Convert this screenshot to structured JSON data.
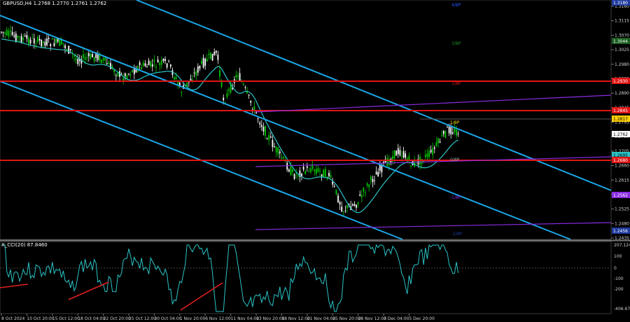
{
  "window": {
    "title": "GBPUSD,H4  1.2768 1.2770 1.2761 1.2762"
  },
  "colors": {
    "background": "#000000",
    "bull_candle": "#00c800",
    "bear_candle": "#ffffff",
    "channel": "#1aa7e6",
    "ma": "#2bc4c7",
    "resistance_red": "#e01414",
    "murrey_purple": "#8a2be2",
    "cci_line": "#2bc4c7",
    "divergence": "#e02020"
  },
  "price_axis": {
    "labels": [
      "1.3160",
      "1.3115",
      "1.3070",
      "1.3025",
      "1.2980",
      "1.2935",
      "1.2890",
      "1.2845",
      "1.2795",
      "1.2750",
      "1.2705",
      "1.2660",
      "1.2615",
      "1.2570",
      "1.2525",
      "1.2480",
      "1.2435"
    ]
  },
  "price_tags": [
    {
      "id": "tag-1",
      "text": "1.2817",
      "color": "#ffd000",
      "textColor": "#000"
    },
    {
      "id": "tag-2",
      "text": "1.2762",
      "color": "#ffffff",
      "textColor": "#000"
    },
    {
      "id": "tag-3",
      "text": "1.2695",
      "color": "#2bc4c7",
      "textColor": "#000"
    },
    {
      "id": "tag-4",
      "text": "1.2680",
      "color": "#e01414",
      "textColor": "#fff"
    },
    {
      "id": "tag-5",
      "text": "1.2930",
      "color": "#e01414",
      "textColor": "#fff"
    },
    {
      "id": "tag-6",
      "text": "1.2845",
      "color": "#e01414",
      "textColor": "#fff"
    },
    {
      "id": "tag-7",
      "text": "1.2562",
      "color": "#8a2be2",
      "textColor": "#fff"
    },
    {
      "id": "tag-8",
      "text": "1.3180",
      "color": "#1e3aa0",
      "textColor": "#fff"
    },
    {
      "id": "tag-9",
      "text": "1.3044",
      "color": "#1b5e20",
      "textColor": "#fff"
    },
    {
      "id": "tag-10",
      "text": "1.2456",
      "color": "#1e3aa0",
      "textColor": "#fff"
    }
  ],
  "level_labels": [
    {
      "id": "lvl-red-1",
      "text": "1/8P",
      "color": "#e01414"
    },
    {
      "id": "lvl-yellow",
      "text": "1/8P",
      "color": "#ffd000"
    },
    {
      "id": "lvl-pivot",
      "text": "0/8P",
      "color": "#9aa0a6"
    },
    {
      "id": "lvl-blue",
      "text": "4/8P",
      "color": "#2255ff"
    },
    {
      "id": "lvl-green",
      "text": "3/8P",
      "color": "#1b8f2a"
    },
    {
      "id": "lvl-purple",
      "text": "-1/8P",
      "color": "#8a2be2"
    },
    {
      "id": "lvl-blue-low",
      "text": "-2/8P",
      "color": "#1e3aa0"
    }
  ],
  "cci": {
    "title": "X_CCI(20) 87.8460",
    "axis_labels": [
      "207.1248",
      "100",
      "0",
      "-100",
      "-200",
      "-406.6757"
    ]
  },
  "time_axis": {
    "labels": [
      "8 Oct 2024",
      "10 Oct 20:00",
      "15 Oct 12:00",
      "18 Oct 04:00",
      "22 Oct 20:00",
      "25 Oct 12:00",
      "30 Oct 04:00",
      "1 Nov 20:00",
      "6 Nov 12:00",
      "11 Nov 04:00",
      "13 Nov 20:00",
      "18 Nov 12:00",
      "21 Nov 04:00",
      "25 Nov 20:00",
      "28 Nov 12:00",
      "3 Dec 04:00",
      "5 Dec 20:00"
    ]
  }
}
